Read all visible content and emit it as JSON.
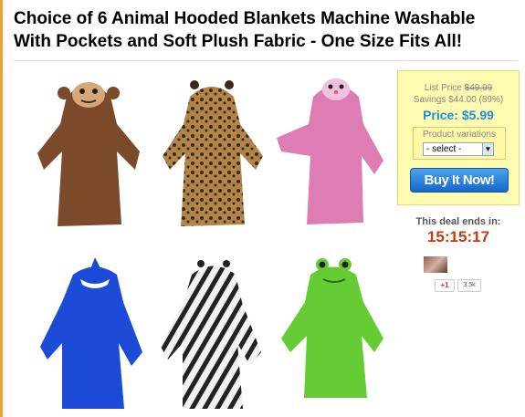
{
  "product": {
    "title": "Choice of 6 Animal Hooded Blankets Machine Washable With Pockets and Soft Plush Fabric - One Size Fits All!"
  },
  "images": [
    {
      "name": "monkey",
      "color": "#7b4a2a"
    },
    {
      "name": "leopard",
      "color": "#a9793e"
    },
    {
      "name": "pink-cat",
      "color": "#dd7db3"
    },
    {
      "name": "shark",
      "color": "#1c4bd8"
    },
    {
      "name": "zebra",
      "color": "#333333"
    },
    {
      "name": "frog",
      "color": "#66cc33"
    }
  ],
  "pricing": {
    "list_price_label": "List Price",
    "list_price": "$49.99",
    "savings_label": "Savings",
    "savings": "$44.00 (89%)",
    "price_label": "Price:",
    "price": "$5.99",
    "variations_label": "Product variations",
    "select_value": "- select -",
    "buy_button": "Buy It Now!"
  },
  "deal": {
    "ends_label": "This deal ends in:",
    "timer": "15:15:17"
  },
  "social": {
    "gplus_label": "+1",
    "count": "3.5k"
  },
  "colors": {
    "accent_border": "#f0a030",
    "price_blue": "#1a8fd6",
    "timer_red": "#c43a0c",
    "buy_button": "#1667c9"
  }
}
